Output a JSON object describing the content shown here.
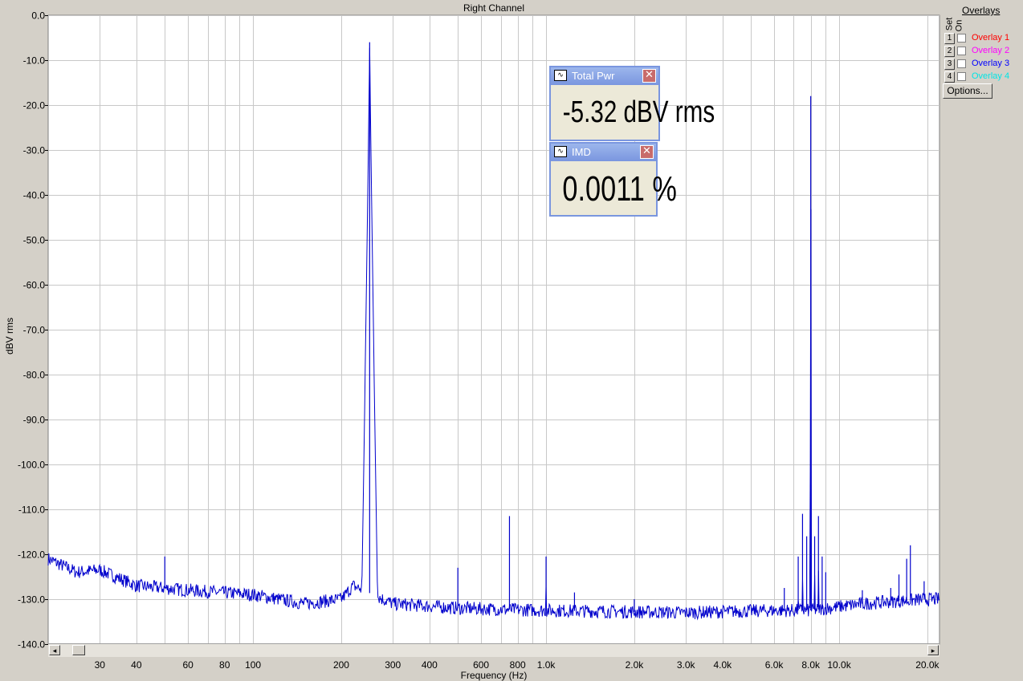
{
  "window": {
    "title": "Right Channel"
  },
  "chart_data": {
    "type": "line",
    "title": "Right Channel",
    "xlabel": "Frequency (Hz)",
    "ylabel": "dBV rms",
    "xscale": "log",
    "xlim": [
      20,
      22000
    ],
    "ylim": [
      -140,
      0
    ],
    "grid": true,
    "yticks": [
      0,
      -10,
      -20,
      -30,
      -40,
      -50,
      -60,
      -70,
      -80,
      -90,
      -100,
      -110,
      -120,
      -130,
      -140
    ],
    "ytick_labels": [
      "0.0",
      "-10.0",
      "-20.0",
      "-30.0",
      "-40.0",
      "-50.0",
      "-60.0",
      "-70.0",
      "-80.0",
      "-90.0",
      "-100.0",
      "-110.0",
      "-120.0",
      "-130.0",
      "-140.0"
    ],
    "xticks": [
      30,
      40,
      60,
      80,
      100,
      200,
      300,
      400,
      600,
      800,
      1000,
      2000,
      3000,
      4000,
      6000,
      8000,
      10000,
      20000
    ],
    "xtick_labels": [
      "30",
      "40",
      "60",
      "80",
      "100",
      "200",
      "300",
      "400",
      "600",
      "800",
      "1.0k",
      "2.0k",
      "3.0k",
      "4.0k",
      "6.0k",
      "8.0k",
      "10.0k",
      "20.0k"
    ],
    "series": [
      {
        "color": "#0000cc",
        "noise_floor": [
          [
            20,
            -121
          ],
          [
            25,
            -124
          ],
          [
            30,
            -123.5
          ],
          [
            40,
            -127
          ],
          [
            60,
            -128
          ],
          [
            100,
            -129
          ],
          [
            150,
            -131
          ],
          [
            200,
            -130
          ],
          [
            220,
            -127
          ],
          [
            300,
            -131
          ],
          [
            500,
            -132
          ],
          [
            1000,
            -132.5
          ],
          [
            3000,
            -133
          ],
          [
            6000,
            -132.5
          ],
          [
            8000,
            -132.5
          ],
          [
            12000,
            -131
          ],
          [
            20000,
            -130
          ],
          [
            22000,
            -130
          ]
        ],
        "tones": [
          {
            "freq": 250,
            "level": -6
          },
          {
            "freq": 8000,
            "level": -18
          },
          {
            "freq": 50,
            "level": -120.5
          },
          {
            "freq": 500,
            "level": -123
          },
          {
            "freq": 750,
            "level": -111.5
          },
          {
            "freq": 1000,
            "level": -120.5
          },
          {
            "freq": 1250,
            "level": -128.5
          },
          {
            "freq": 2000,
            "level": -130
          },
          {
            "freq": 6500,
            "level": -127.5
          },
          {
            "freq": 7250,
            "level": -120.5
          },
          {
            "freq": 7500,
            "level": -111
          },
          {
            "freq": 7750,
            "level": -116
          },
          {
            "freq": 8250,
            "level": -116
          },
          {
            "freq": 8500,
            "level": -111.5
          },
          {
            "freq": 8750,
            "level": -120.5
          },
          {
            "freq": 9000,
            "level": -124
          },
          {
            "freq": 12000,
            "level": -128
          },
          {
            "freq": 15000,
            "level": -127.5
          },
          {
            "freq": 16000,
            "level": -124.5
          },
          {
            "freq": 17000,
            "level": -121
          },
          {
            "freq": 17500,
            "level": -118
          },
          {
            "freq": 19500,
            "level": -126
          }
        ]
      }
    ]
  },
  "overlays": {
    "title": "Overlays",
    "set_label": "Set",
    "on_label": "On",
    "items": [
      {
        "num": "1",
        "name": "Overlay 1",
        "color": "#ff0000"
      },
      {
        "num": "2",
        "name": "Overlay 2",
        "color": "#ff00ff"
      },
      {
        "num": "3",
        "name": "Overlay 3",
        "color": "#0000ff"
      },
      {
        "num": "4",
        "name": "Overlay 4",
        "color": "#00e5e5"
      }
    ],
    "options_label": "Options..."
  },
  "meters": {
    "total_pwr": {
      "title": "Total Pwr",
      "value": "-5.32 dBV rms"
    },
    "imd": {
      "title": "IMD",
      "value": "0.0011 %"
    }
  },
  "scrollbar": {
    "left_arrow": "◂",
    "right_arrow": "▸"
  },
  "icons": {
    "meter": "waveform-icon",
    "close": "close-icon"
  }
}
